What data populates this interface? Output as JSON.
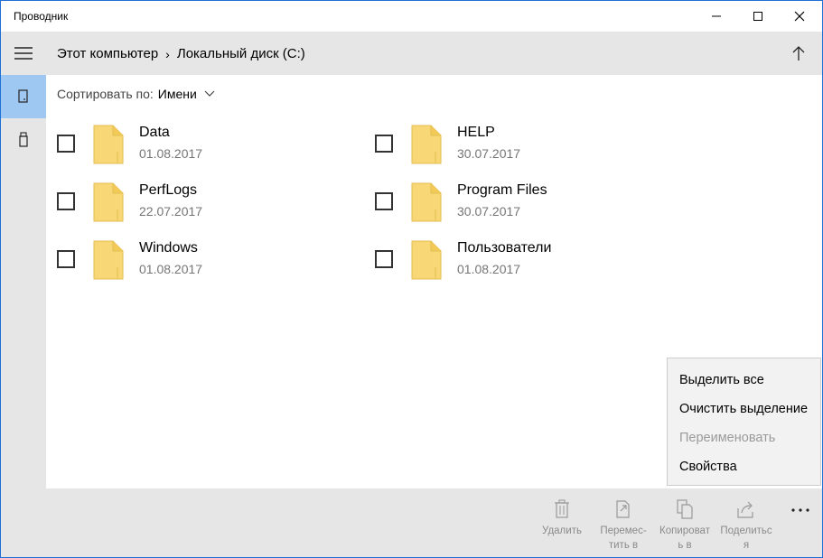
{
  "window": {
    "title": "Проводник"
  },
  "breadcrumb": {
    "items": [
      "Этот компьютер",
      "Локальный диск (C:)"
    ],
    "separator": "›"
  },
  "sort": {
    "label": "Сортировать по:",
    "value": "Имени"
  },
  "files": [
    {
      "name": "Data",
      "date": "01.08.2017"
    },
    {
      "name": "HELP",
      "date": "30.07.2017"
    },
    {
      "name": "PerfLogs",
      "date": "22.07.2017"
    },
    {
      "name": "Program Files",
      "date": "30.07.2017"
    },
    {
      "name": "Windows",
      "date": "01.08.2017"
    },
    {
      "name": "Пользователи",
      "date": "01.08.2017"
    }
  ],
  "context_menu": {
    "items": [
      {
        "label": "Выделить все",
        "enabled": true
      },
      {
        "label": "Очистить выделение",
        "enabled": true
      },
      {
        "label": "Переименовать",
        "enabled": false
      },
      {
        "label": "Свойства",
        "enabled": true
      }
    ]
  },
  "commands": [
    {
      "label": "Удалить",
      "icon": "trash-icon"
    },
    {
      "label": "Перемес-\nтить в",
      "icon": "move-icon"
    },
    {
      "label": "Копироват\nь в",
      "icon": "copy-icon"
    },
    {
      "label": "Поделитьс\nя",
      "icon": "share-icon"
    }
  ],
  "colors": {
    "accent_border": "#1f6fd6",
    "rail_active": "#9ec8f1",
    "chrome_gray": "#e6e6e6",
    "folder_yellow": "#f8d876"
  }
}
